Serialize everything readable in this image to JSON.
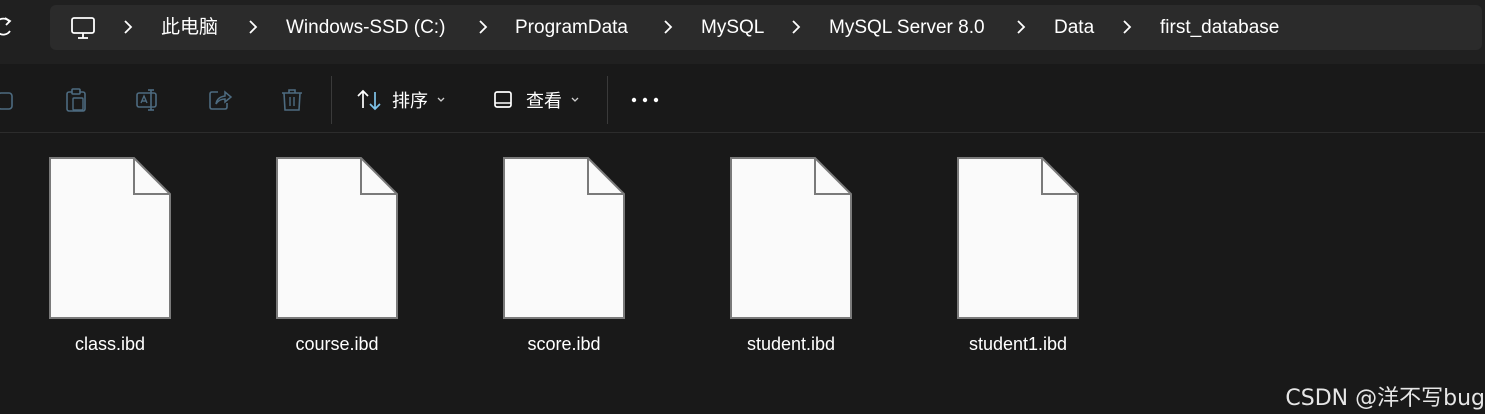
{
  "address_bar": {
    "icon": "pc-icon",
    "crumbs": [
      "此电脑",
      "Windows-SSD (C:)",
      "ProgramData",
      "MySQL",
      "MySQL Server 8.0",
      "Data",
      "first_database"
    ]
  },
  "toolbar": {
    "icons": [
      "copy-icon",
      "paste-icon",
      "rename-icon",
      "share-icon",
      "delete-icon"
    ],
    "sort_label": "排序",
    "view_label": "查看",
    "more_label": "···"
  },
  "files": [
    {
      "name": "class.ibd"
    },
    {
      "name": "course.ibd"
    },
    {
      "name": "score.ibd"
    },
    {
      "name": "student.ibd"
    },
    {
      "name": "student1.ibd"
    }
  ],
  "watermark": "CSDN @洋不写bug",
  "colors": {
    "background": "#191919",
    "address_bar": "#2b2b2b",
    "top_strip": "#202020",
    "file_page": "#fafafa",
    "disabled_icon": "#4d6b80"
  }
}
